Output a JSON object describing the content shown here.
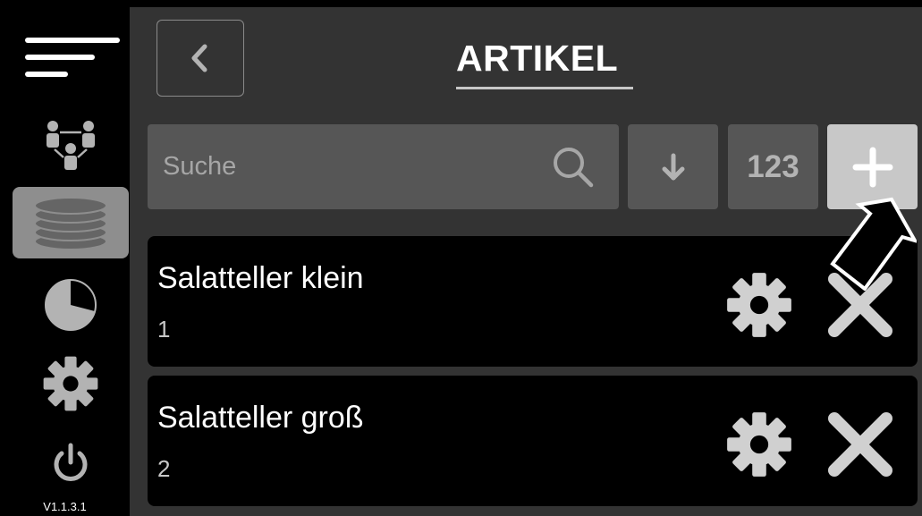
{
  "sidebar": {
    "nav": [
      {
        "icon": "hamburger-menu-icon"
      },
      {
        "icon": "users-hierarchy-icon"
      },
      {
        "icon": "database-icon",
        "active": true
      },
      {
        "icon": "pie-chart-icon"
      },
      {
        "icon": "gear-icon"
      },
      {
        "icon": "power-icon"
      }
    ],
    "version": "V1.1.3.1"
  },
  "header": {
    "back_icon": "chevron-left-icon",
    "title": "ARTIKEL"
  },
  "toolbar": {
    "search_placeholder": "Suche",
    "search_value": "",
    "sort_icon": "arrow-down-icon",
    "numeric_label": "123",
    "add_icon": "plus-icon"
  },
  "items": [
    {
      "name": "Salatteller klein",
      "number": "1"
    },
    {
      "name": "Salatteller groß",
      "number": "2"
    }
  ],
  "colors": {
    "background": "#000000",
    "panel": "#333333",
    "control": "#565656",
    "active": "#8e8e8e",
    "add_button": "#c8c8c8"
  }
}
